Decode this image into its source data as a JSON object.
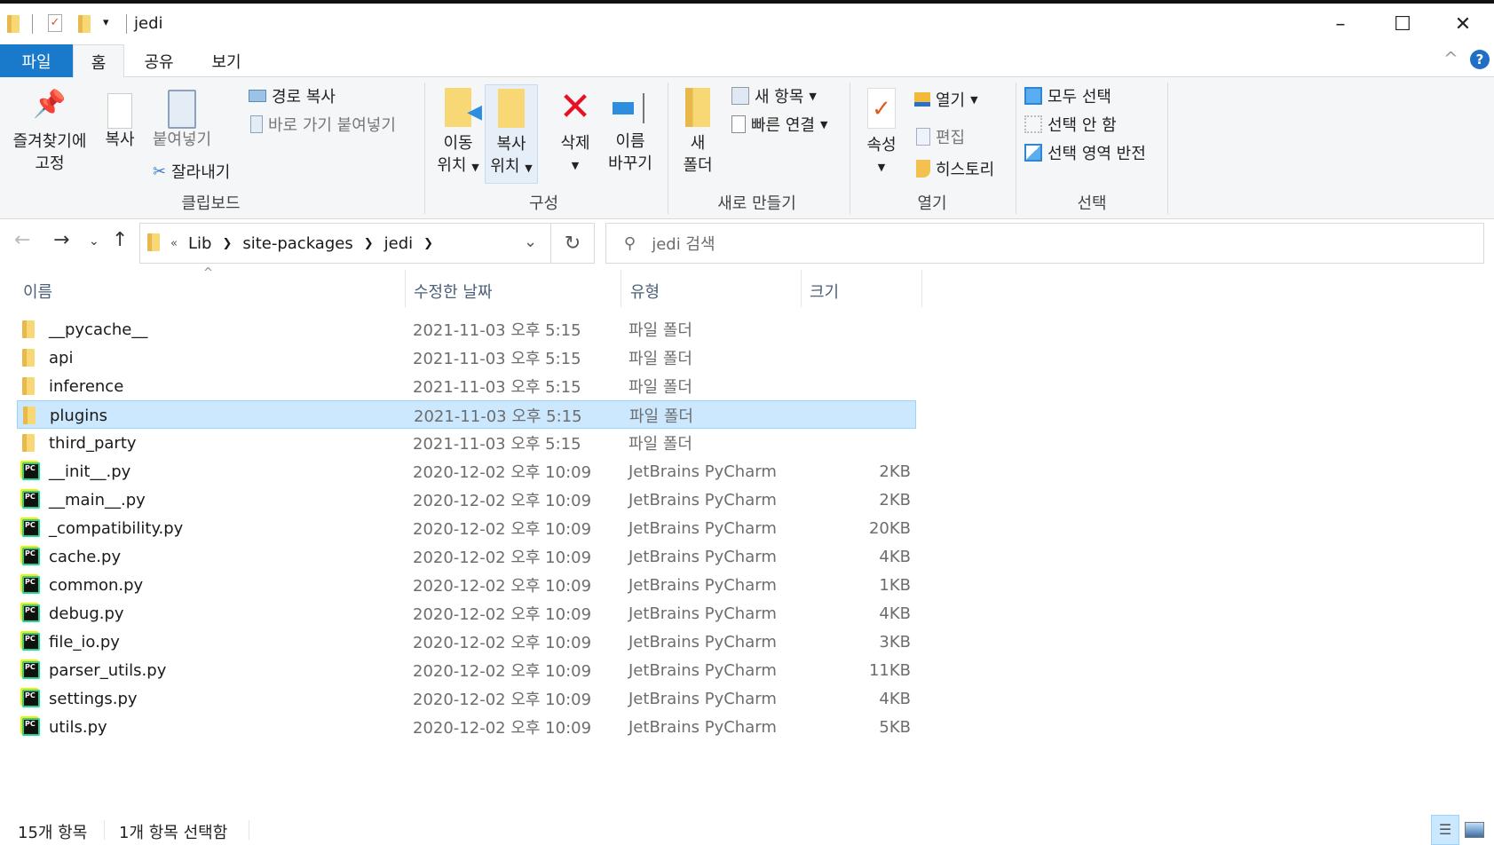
{
  "window": {
    "title": "jedi",
    "minimize": "–",
    "maximize": "☐",
    "close": "✕"
  },
  "tabs": [
    {
      "label": "파일"
    },
    {
      "label": "홈"
    },
    {
      "label": "공유"
    },
    {
      "label": "보기"
    }
  ],
  "ribbon": {
    "clipboard": {
      "label": "클립보드",
      "pin": "즐겨찾기에\n고정",
      "pin1": "즐겨찾기에",
      "pin2": "고정",
      "copy": "복사",
      "paste": "붙여넣기",
      "copy_path": "경로 복사",
      "paste_shortcut": "바로 가기 붙여넣기",
      "cut": "잘라내기"
    },
    "organize": {
      "label": "구성",
      "move1": "이동",
      "move2": "위치",
      "copy1": "복사",
      "copy2": "위치",
      "delete": "삭제",
      "rename1": "이름",
      "rename2": "바꾸기"
    },
    "new": {
      "label": "새로 만들기",
      "folder1": "새",
      "folder2": "폴더",
      "new_item": "새 항목",
      "easy_access": "빠른 연결"
    },
    "open": {
      "label": "열기",
      "properties": "속성",
      "open": "열기",
      "edit": "편집",
      "history": "히스토리"
    },
    "select": {
      "label": "선택",
      "all": "모두 선택",
      "none": "선택 안 함",
      "invert": "선택 영역 반전"
    }
  },
  "address": {
    "overflow": "«",
    "crumbs": [
      "Lib",
      "site-packages",
      "jedi"
    ],
    "search_placeholder": "jedi 검색"
  },
  "columns": {
    "name": "이름",
    "date": "수정한 날짜",
    "type": "유형",
    "size": "크기"
  },
  "files": [
    {
      "name": "__pycache__",
      "date": "2021-11-03 오후 5:15",
      "type": "파일 폴더",
      "size": "",
      "kind": "folder"
    },
    {
      "name": "api",
      "date": "2021-11-03 오후 5:15",
      "type": "파일 폴더",
      "size": "",
      "kind": "folder"
    },
    {
      "name": "inference",
      "date": "2021-11-03 오후 5:15",
      "type": "파일 폴더",
      "size": "",
      "kind": "folder"
    },
    {
      "name": "plugins",
      "date": "2021-11-03 오후 5:15",
      "type": "파일 폴더",
      "size": "",
      "kind": "folder",
      "selected": true
    },
    {
      "name": "third_party",
      "date": "2021-11-03 오후 5:15",
      "type": "파일 폴더",
      "size": "",
      "kind": "folder"
    },
    {
      "name": "__init__.py",
      "date": "2020-12-02 오후 10:09",
      "type": "JetBrains PyCharm",
      "size": "2KB",
      "kind": "py"
    },
    {
      "name": "__main__.py",
      "date": "2020-12-02 오후 10:09",
      "type": "JetBrains PyCharm",
      "size": "2KB",
      "kind": "py"
    },
    {
      "name": "_compatibility.py",
      "date": "2020-12-02 오후 10:09",
      "type": "JetBrains PyCharm",
      "size": "20KB",
      "kind": "py"
    },
    {
      "name": "cache.py",
      "date": "2020-12-02 오후 10:09",
      "type": "JetBrains PyCharm",
      "size": "4KB",
      "kind": "py"
    },
    {
      "name": "common.py",
      "date": "2020-12-02 오후 10:09",
      "type": "JetBrains PyCharm",
      "size": "1KB",
      "kind": "py"
    },
    {
      "name": "debug.py",
      "date": "2020-12-02 오후 10:09",
      "type": "JetBrains PyCharm",
      "size": "4KB",
      "kind": "py"
    },
    {
      "name": "file_io.py",
      "date": "2020-12-02 오후 10:09",
      "type": "JetBrains PyCharm",
      "size": "3KB",
      "kind": "py"
    },
    {
      "name": "parser_utils.py",
      "date": "2020-12-02 오후 10:09",
      "type": "JetBrains PyCharm",
      "size": "11KB",
      "kind": "py"
    },
    {
      "name": "settings.py",
      "date": "2020-12-02 오후 10:09",
      "type": "JetBrains PyCharm",
      "size": "4KB",
      "kind": "py"
    },
    {
      "name": "utils.py",
      "date": "2020-12-02 오후 10:09",
      "type": "JetBrains PyCharm",
      "size": "5KB",
      "kind": "py"
    }
  ],
  "status": {
    "count": "15개 항목",
    "selected": "1개 항목 선택함"
  },
  "colors": {
    "file_tab": "#1979ca",
    "selection": "#cce8ff",
    "selection_border": "#99d1ff",
    "pycharm_green": "#21d789"
  }
}
